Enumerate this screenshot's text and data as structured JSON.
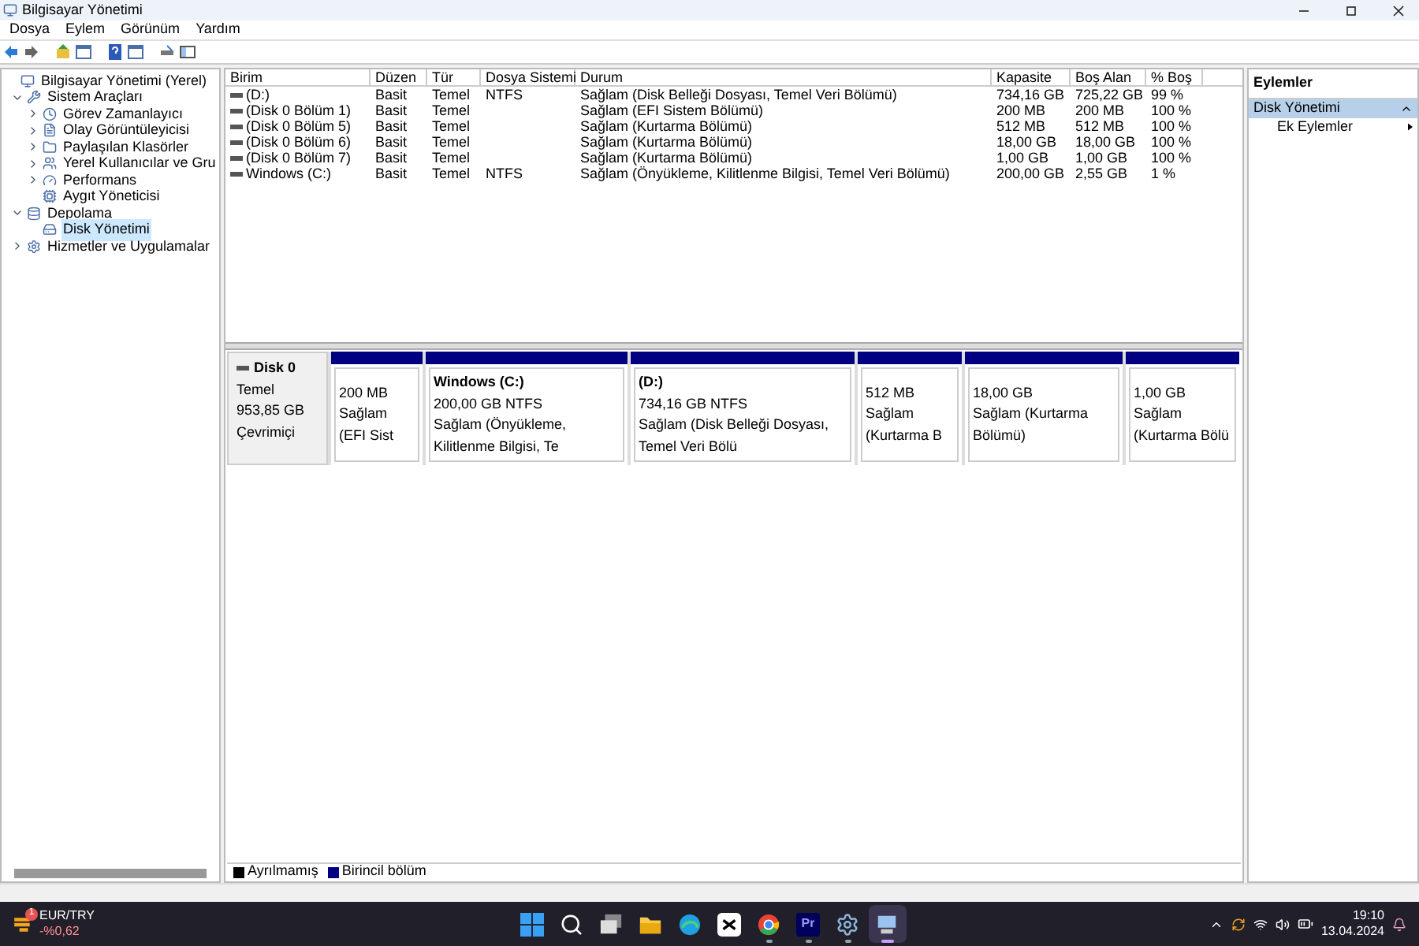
{
  "window": {
    "title": "Bilgisayar Yönetimi"
  },
  "menu": [
    "Dosya",
    "Eylem",
    "Görünüm",
    "Yardım"
  ],
  "tree": [
    {
      "label": "Bilgisayar Yönetimi (Yerel)",
      "selected": false,
      "children": [
        {
          "label": "Sistem Araçları",
          "expanded": true,
          "selected": false,
          "children": [
            {
              "label": "Görev Zamanlayıcı",
              "expanded": false,
              "selected": false
            },
            {
              "label": "Olay Görüntüleyicisi",
              "expanded": false,
              "selected": false
            },
            {
              "label": "Paylaşılan Klasörler",
              "expanded": false,
              "selected": false
            },
            {
              "label": "Yerel Kullanıcılar ve Gru",
              "expanded": false,
              "selected": false
            },
            {
              "label": "Performans",
              "expanded": false,
              "selected": false
            },
            {
              "label": "Aygıt Yöneticisi",
              "selected": false
            }
          ]
        },
        {
          "label": "Depolama",
          "expanded": true,
          "selected": false,
          "children": [
            {
              "label": "Disk Yönetimi",
              "selected": true
            }
          ]
        },
        {
          "label": "Hizmetler ve Uygulamalar",
          "expanded": false,
          "selected": false
        }
      ]
    }
  ],
  "table": {
    "columns": [
      "Birim",
      "Düzen",
      "Tür",
      "Dosya Sistemi",
      "Durum",
      "Kapasite",
      "Boş Alan",
      "% Boş"
    ],
    "rows": [
      [
        "(D:)",
        "Basit",
        "Temel",
        "NTFS",
        "Sağlam (Disk Belleği Dosyası, Temel Veri Bölümü)",
        "734,16 GB",
        "725,22 GB",
        "99 %"
      ],
      [
        "(Disk 0 Bölüm 1)",
        "Basit",
        "Temel",
        "",
        "Sağlam (EFI Sistem Bölümü)",
        "200 MB",
        "200 MB",
        "100 %"
      ],
      [
        "(Disk 0 Bölüm 5)",
        "Basit",
        "Temel",
        "",
        "Sağlam (Kurtarma Bölümü)",
        "512 MB",
        "512 MB",
        "100 %"
      ],
      [
        "(Disk 0 Bölüm 6)",
        "Basit",
        "Temel",
        "",
        "Sağlam (Kurtarma Bölümü)",
        "18,00 GB",
        "18,00 GB",
        "100 %"
      ],
      [
        "(Disk 0 Bölüm 7)",
        "Basit",
        "Temel",
        "",
        "Sağlam (Kurtarma Bölümü)",
        "1,00 GB",
        "1,00 GB",
        "100 %"
      ],
      [
        "Windows (C:)",
        "Basit",
        "Temel",
        "NTFS",
        "Sağlam (Önyükleme, Kilitlenme Bilgisi, Temel Veri Bölümü)",
        "200,00 GB",
        "2,55 GB",
        "1 %"
      ]
    ]
  },
  "disk": {
    "name": "Disk 0",
    "type": "Temel",
    "size": "953,85 GB",
    "state": "Çevrimiçi",
    "partitions": [
      {
        "size": "200 MB",
        "status": "Sağlam (EFI Sist"
      },
      {
        "title": "Windows  (C:)",
        "size": "200,00 GB NTFS",
        "status": "Sağlam (Önyükleme, Kilitlenme Bilgisi, Te"
      },
      {
        "title": "(D:)",
        "size": "734,16 GB NTFS",
        "status": "Sağlam (Disk Belleği Dosyası, Temel Veri Bölü"
      },
      {
        "size": "512 MB",
        "status": "Sağlam (Kurtarma B"
      },
      {
        "size": "18,00 GB",
        "status": "Sağlam (Kurtarma Bölümü)"
      },
      {
        "size": "1,00 GB",
        "status": "Sağlam (Kurtarma Bölü"
      }
    ]
  },
  "legend": [
    {
      "label": "Ayrılmamış",
      "color": "#000000"
    },
    {
      "label": "Birincil bölüm",
      "color": "#000080"
    }
  ],
  "actions": {
    "title": "Eylemler",
    "section": {
      "label": "Disk Yönetimi",
      "expanded": true
    },
    "items": [
      "Ek Eylemler"
    ]
  },
  "taskbar": {
    "widget": {
      "title": "EUR/TRY",
      "change": "-%0,62",
      "badge": "1"
    },
    "apps": [
      {
        "kind": "start",
        "running": false,
        "selected": false
      },
      {
        "kind": "search",
        "running": false,
        "selected": false
      },
      {
        "kind": "taskview",
        "running": false,
        "selected": false
      },
      {
        "kind": "explorer",
        "running": false,
        "selected": false
      },
      {
        "kind": "edge",
        "running": false,
        "selected": false
      },
      {
        "kind": "capcut",
        "running": false,
        "selected": false
      },
      {
        "kind": "chrome",
        "running": true,
        "selected": false
      },
      {
        "kind": "premiere",
        "label": "Pr",
        "running": true,
        "selected": false
      },
      {
        "kind": "settings",
        "running": true,
        "selected": false
      },
      {
        "kind": "compmgmt",
        "running": true,
        "selected": true
      }
    ],
    "time": "19:10",
    "date": "13.04.2024"
  }
}
